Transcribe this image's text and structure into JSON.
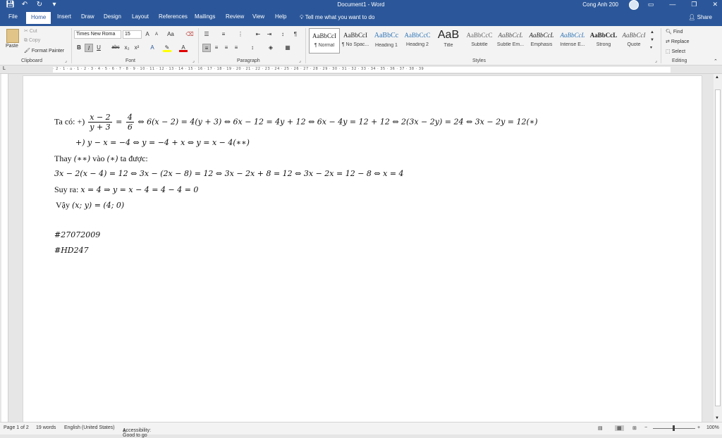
{
  "window": {
    "doc_title": "Document1 - Word",
    "user_name": "Cong Anh 200",
    "share_label": "Share",
    "tell_me_placeholder": "Tell me what you want to do"
  },
  "tabs": [
    "File",
    "Home",
    "Insert",
    "Draw",
    "Design",
    "Layout",
    "References",
    "Mailings",
    "Review",
    "View",
    "Help"
  ],
  "clipboard": {
    "paste": "Paste",
    "cut": "Cut",
    "copy": "Copy",
    "format_painter": "Format Painter",
    "label": "Clipboard"
  },
  "font": {
    "family": "Times New Roma",
    "size": "15",
    "label": "Font"
  },
  "paragraph": {
    "label": "Paragraph"
  },
  "styles": {
    "label": "Styles",
    "items": [
      {
        "sample": "AaBbCcI",
        "name": "¶ Normal"
      },
      {
        "sample": "AaBbCcI",
        "name": "¶ No Spac..."
      },
      {
        "sample": "AaBbCc",
        "name": "Heading 1"
      },
      {
        "sample": "AaBbCcC",
        "name": "Heading 2"
      },
      {
        "sample": "AaB",
        "name": "Title"
      },
      {
        "sample": "AaBbCcC",
        "name": "Subtitle"
      },
      {
        "sample": "AaBbCcL",
        "name": "Subtle Em..."
      },
      {
        "sample": "AaBbCcL",
        "name": "Emphasis"
      },
      {
        "sample": "AaBbCcL",
        "name": "Intense E..."
      },
      {
        "sample": "AaBbCcL",
        "name": "Strong"
      },
      {
        "sample": "AaBbCcI",
        "name": "Quote"
      }
    ]
  },
  "editing": {
    "find": "Find",
    "replace": "Replace",
    "select": "Select",
    "label": "Editing"
  },
  "ruler_text": "· 2 · 1 · ⌂ · 1 · 2 · 3 · 4 · 5 · 6 · 7 · 8 · 9 · 10 · 11 · 12 · 13 · 14 · 15 · 16 · 17 · 18 · 19 · 20 · 21 · 22 · 23 · 24 · 25 · 26 · 27 · 28 · 29 · 30 · 31 · 32 · 33 · 34 · 35 · 36 · 37 · 38 · 39",
  "document": {
    "l1_prefix": "Ta có: +) ",
    "l1_num1": "x − 2",
    "l1_den1": "y + 3",
    "l1_eq": " = ",
    "l1_num2": "4",
    "l1_den2": "6",
    "l1_rest": " ⇔ 6(x − 2) = 4(y + 3) ⇔ 6x − 12 = 4y + 12 ⇔ 6x − 4y = 12 + 12 ⇔ 2(3x − 2y) = 24 ⇔ 3x − 2y = 12(∗)",
    "l2": "+) y − x = −4 ⇔ y = −4 + x ⇔ y = x − 4(∗∗)",
    "l3_a": "Thay ",
    "l3_b": "(∗∗)",
    "l3_c": " vào ",
    "l3_d": "(∗)",
    "l3_e": " ta được:",
    "l4": "3x − 2(x − 4) = 12 ⇔ 3x − (2x − 8) = 12 ⇔ 3x − 2x + 8 = 12 ⇔ 3x − 2x = 12 − 8 ⇔ x = 4",
    "l5_a": "Suy ra: ",
    "l5_b": "x = 4 ⇒ y = x − 4 = 4 − 4 = 0",
    "l6_a": "Vậy ",
    "l6_b": "(x; y) = (4; 0)",
    "l7": "#27072009",
    "l8": "#HD247"
  },
  "status": {
    "page": "Page 1 of 2",
    "words": "19 words",
    "language": "English (United States)",
    "accessibility": "Accessibility: Good to go",
    "zoom": "100%"
  },
  "colors": {
    "brand": "#2b579a"
  }
}
